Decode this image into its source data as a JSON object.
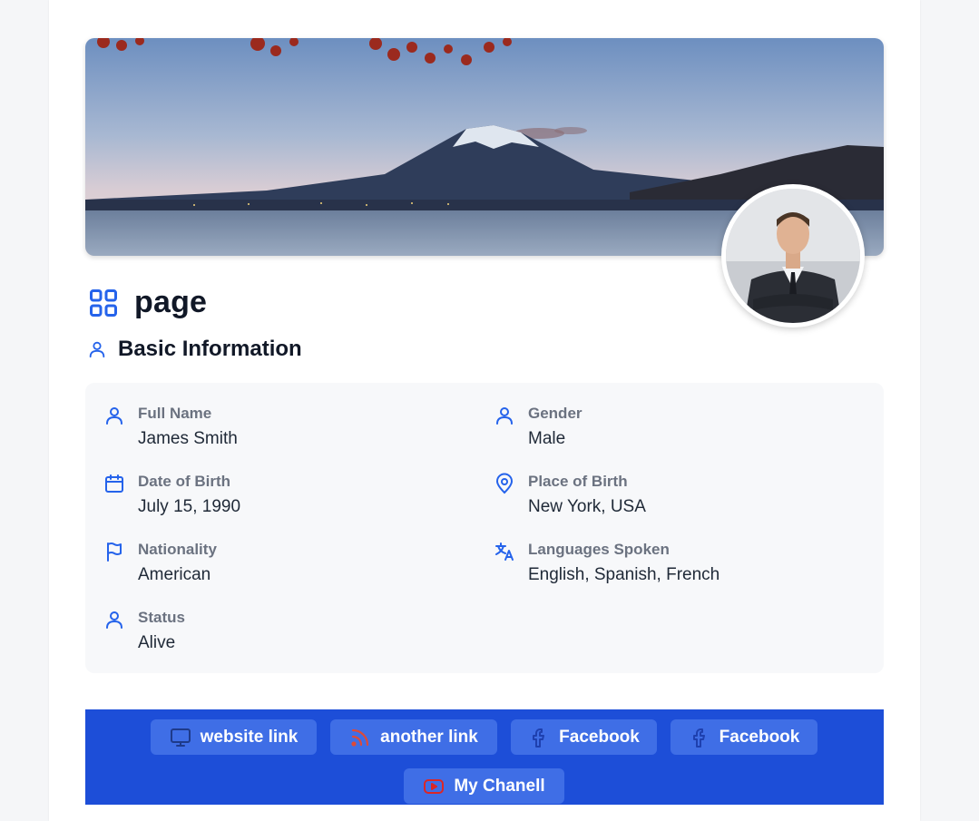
{
  "page": {
    "title": "page",
    "section_title": "Basic Information"
  },
  "info": {
    "full_name": {
      "label": "Full Name",
      "value": "James Smith"
    },
    "gender": {
      "label": "Gender",
      "value": "Male"
    },
    "date_of_birth": {
      "label": "Date of Birth",
      "value": "July 15, 1990"
    },
    "place_of_birth": {
      "label": "Place of Birth",
      "value": "New York, USA"
    },
    "nationality": {
      "label": "Nationality",
      "value": "American"
    },
    "languages": {
      "label": "Languages Spoken",
      "value": "English, Spanish, French"
    },
    "status": {
      "label": "Status",
      "value": "Alive"
    }
  },
  "links": [
    {
      "label": "website link",
      "icon": "monitor-icon"
    },
    {
      "label": "another link",
      "icon": "rss-icon"
    },
    {
      "label": "Facebook",
      "icon": "facebook-icon"
    },
    {
      "label": "Facebook",
      "icon": "facebook-icon"
    },
    {
      "label": "My Chanell",
      "icon": "youtube-icon"
    }
  ],
  "colors": {
    "accent": "#1d4ed8",
    "icon_blue": "#2563eb",
    "link_button": "#3f6ee6",
    "info_background": "#f7f8fa"
  }
}
